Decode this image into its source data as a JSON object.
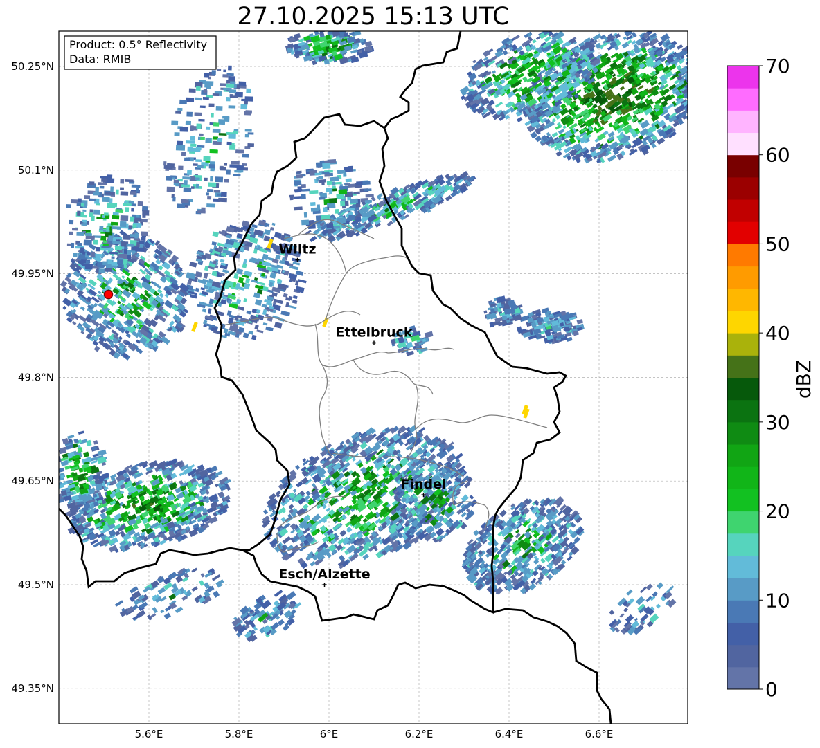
{
  "title": "27.10.2025 15:13 UTC",
  "info_box": {
    "line1": "Product: 0.5° Reflectivity",
    "line2": "Data: RMIB"
  },
  "map": {
    "lon_range": [
      5.4,
      6.8
    ],
    "lat_range": [
      49.3,
      50.3
    ],
    "lat_ticks": [
      "50.25°N",
      "50.1°N",
      "49.95°N",
      "49.8°N",
      "49.65°N",
      "49.5°N",
      "49.35°N"
    ],
    "lon_ticks": [
      "5.6°E",
      "5.8°E",
      "6°E",
      "6.2°E",
      "6.4°E",
      "6.6°E"
    ],
    "gridlines": true,
    "cities": [
      {
        "name": "Wiltz",
        "lon": 5.93,
        "lat": 49.97
      },
      {
        "name": "Ettelbruck",
        "lon": 6.1,
        "lat": 49.85
      },
      {
        "name": "Findel",
        "lon": 6.21,
        "lat": 49.63
      },
      {
        "name": "Esch/Alzette",
        "lon": 5.99,
        "lat": 49.5
      }
    ],
    "radar_site": {
      "lon": 5.51,
      "lat": 49.92,
      "color": "#ff0000"
    }
  },
  "colorbar": {
    "label": "dBZ",
    "ticks": [
      "0",
      "10",
      "20",
      "30",
      "40",
      "50",
      "60",
      "70"
    ],
    "range": [
      0,
      70
    ],
    "colors": [
      "#6374a8",
      "#5165a0",
      "#4360a7",
      "#4a79b5",
      "#589bc6",
      "#62bbd9",
      "#56d4bd",
      "#3fd46f",
      "#12c121",
      "#11b518",
      "#11a514",
      "#0f8b13",
      "#0b7311",
      "#06590b",
      "#457218",
      "#aab20b",
      "#fed600",
      "#ffb700",
      "#ff9b00",
      "#ff7a00",
      "#e20000",
      "#c10000",
      "#9b0000",
      "#790000",
      "#ffe0ff",
      "#ffb4ff",
      "#ff6cff",
      "#ec34ec"
    ]
  }
}
